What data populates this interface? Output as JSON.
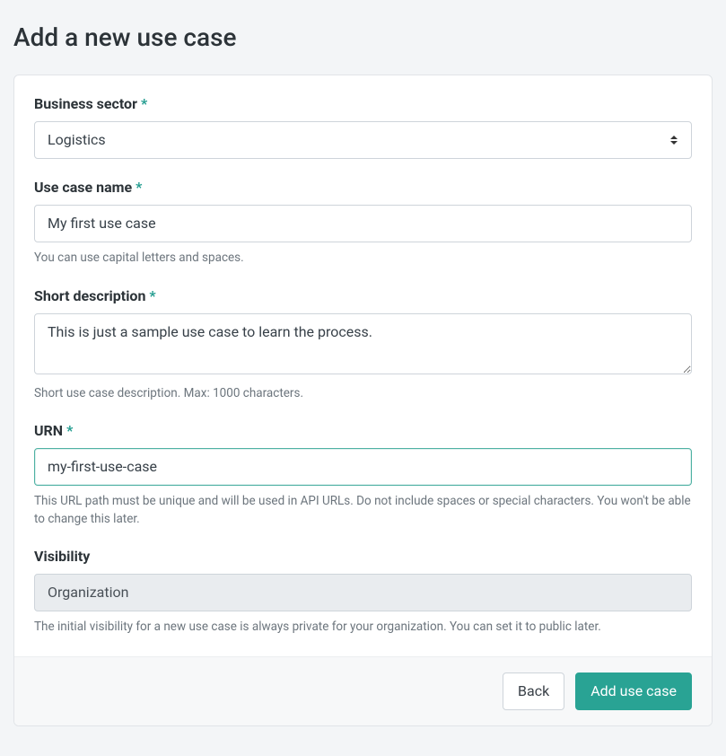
{
  "page": {
    "title": "Add a new use case"
  },
  "required_mark": "*",
  "fields": {
    "business_sector": {
      "label": "Business sector",
      "value": "Logistics"
    },
    "use_case_name": {
      "label": "Use case name",
      "value": "My first use case",
      "help": "You can use capital letters and spaces."
    },
    "short_description": {
      "label": "Short description",
      "value": "This is just a sample use case to learn the process.",
      "help": "Short use case description. Max: 1000 characters."
    },
    "urn": {
      "label": "URN",
      "value": "my-first-use-case",
      "help": "This URL path must be unique and will be used in API URLs. Do not include spaces or special characters. You won't be able to change this later."
    },
    "visibility": {
      "label": "Visibility",
      "value": "Organization",
      "help": "The initial visibility for a new use case is always private for your organization. You can set it to public later."
    }
  },
  "buttons": {
    "back": "Back",
    "submit": "Add use case"
  }
}
